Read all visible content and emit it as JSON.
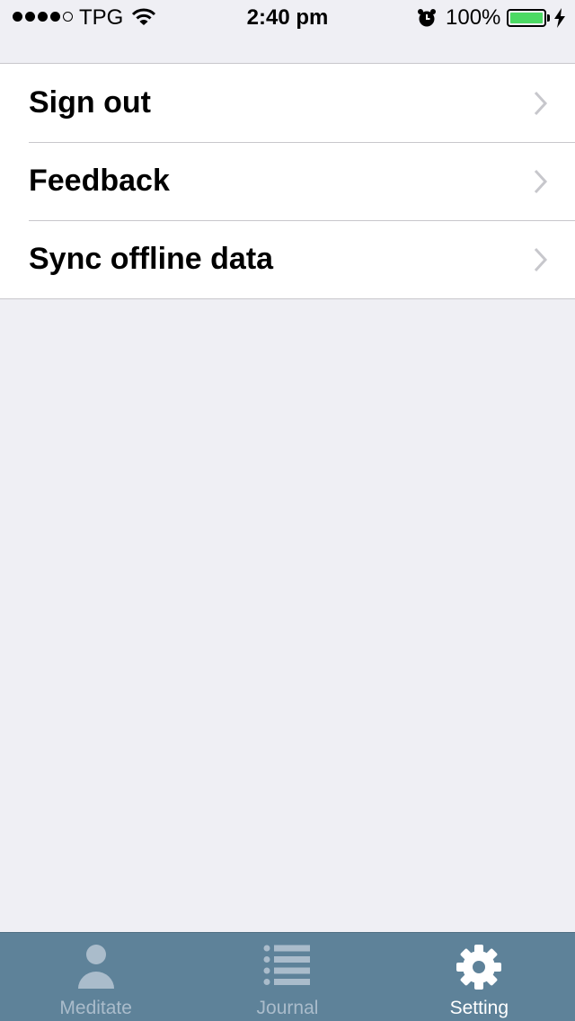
{
  "status_bar": {
    "carrier": "TPG",
    "time": "2:40 pm",
    "battery_percent": "100%",
    "signal_bars_filled": 4,
    "signal_bars_total": 5,
    "battery_level": 1.0,
    "battery_color": "#4cd964"
  },
  "settings": {
    "items": [
      {
        "label": "Sign out",
        "icon": "chevron-right-icon"
      },
      {
        "label": "Feedback",
        "icon": "chevron-right-icon"
      },
      {
        "label": "Sync offline data",
        "icon": "chevron-right-icon"
      }
    ]
  },
  "tab_bar": {
    "background": "#5e8299",
    "active_index": 2,
    "tabs": [
      {
        "label": "Meditate",
        "icon": "person-icon"
      },
      {
        "label": "Journal",
        "icon": "list-icon"
      },
      {
        "label": "Setting",
        "icon": "gear-icon"
      }
    ]
  }
}
